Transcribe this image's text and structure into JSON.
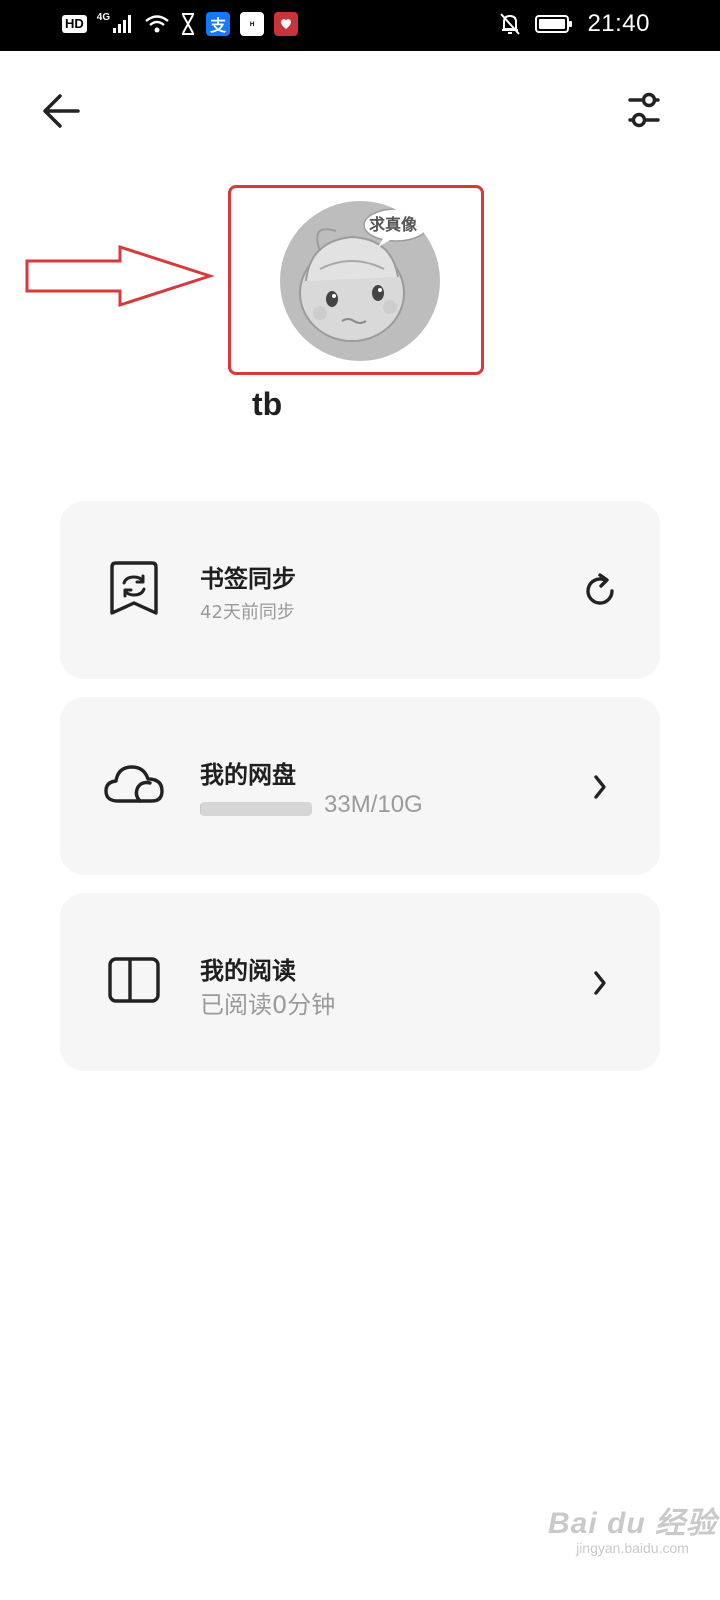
{
  "status_bar": {
    "hd_badge": "HD",
    "network": "4G",
    "time": "21:40",
    "icons": [
      "hd-icon",
      "signal-icon",
      "wifi-icon",
      "hourglass-icon",
      "alipay-icon",
      "huawei-app-icon",
      "app-icon",
      "bell-off-icon",
      "battery-icon"
    ]
  },
  "toolbar": {
    "back_icon": "arrow-left-icon",
    "settings_icon": "sliders-icon"
  },
  "profile": {
    "avatar_caption": "求真像",
    "username": "tb"
  },
  "cards": [
    {
      "title": "书签同步",
      "subtitle": "42天前同步",
      "icon": "bookmark-sync-icon",
      "action_icon": "refresh-icon"
    },
    {
      "title": "我的网盘",
      "storage_text": "33M/10G",
      "storage_used_fraction": 0.0033,
      "icon": "cloud-icon",
      "action_icon": "chevron-right-icon"
    },
    {
      "title": "我的阅读",
      "subtitle": "已阅读0分钟",
      "icon": "book-icon",
      "action_icon": "chevron-right-icon"
    }
  ],
  "watermark": {
    "main": "Bai du 经验",
    "sub": "jingyan.baidu.com"
  },
  "colors": {
    "annotation_red": "#d8393c",
    "card_bg": "#f6f6f6",
    "secondary_text": "#9a9a9a"
  }
}
